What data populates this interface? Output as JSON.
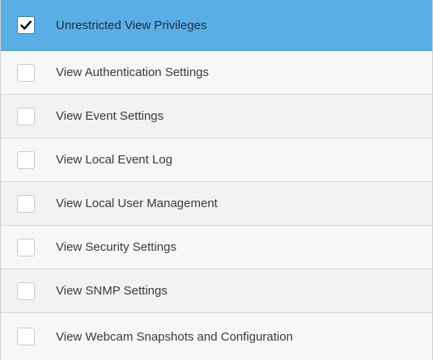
{
  "privileges": {
    "items": [
      {
        "label": "Unrestricted View Privileges",
        "checked": true
      },
      {
        "label": "View Authentication Settings",
        "checked": false
      },
      {
        "label": "View Event Settings",
        "checked": false
      },
      {
        "label": "View Local Event Log",
        "checked": false
      },
      {
        "label": "View Local User Management",
        "checked": false
      },
      {
        "label": "View Security Settings",
        "checked": false
      },
      {
        "label": "View SNMP Settings",
        "checked": false
      },
      {
        "label": "View Webcam Snapshots and Configuration",
        "checked": false
      }
    ],
    "selected_row_color": "#5aaee6",
    "check_icon": "checkmark-icon"
  }
}
